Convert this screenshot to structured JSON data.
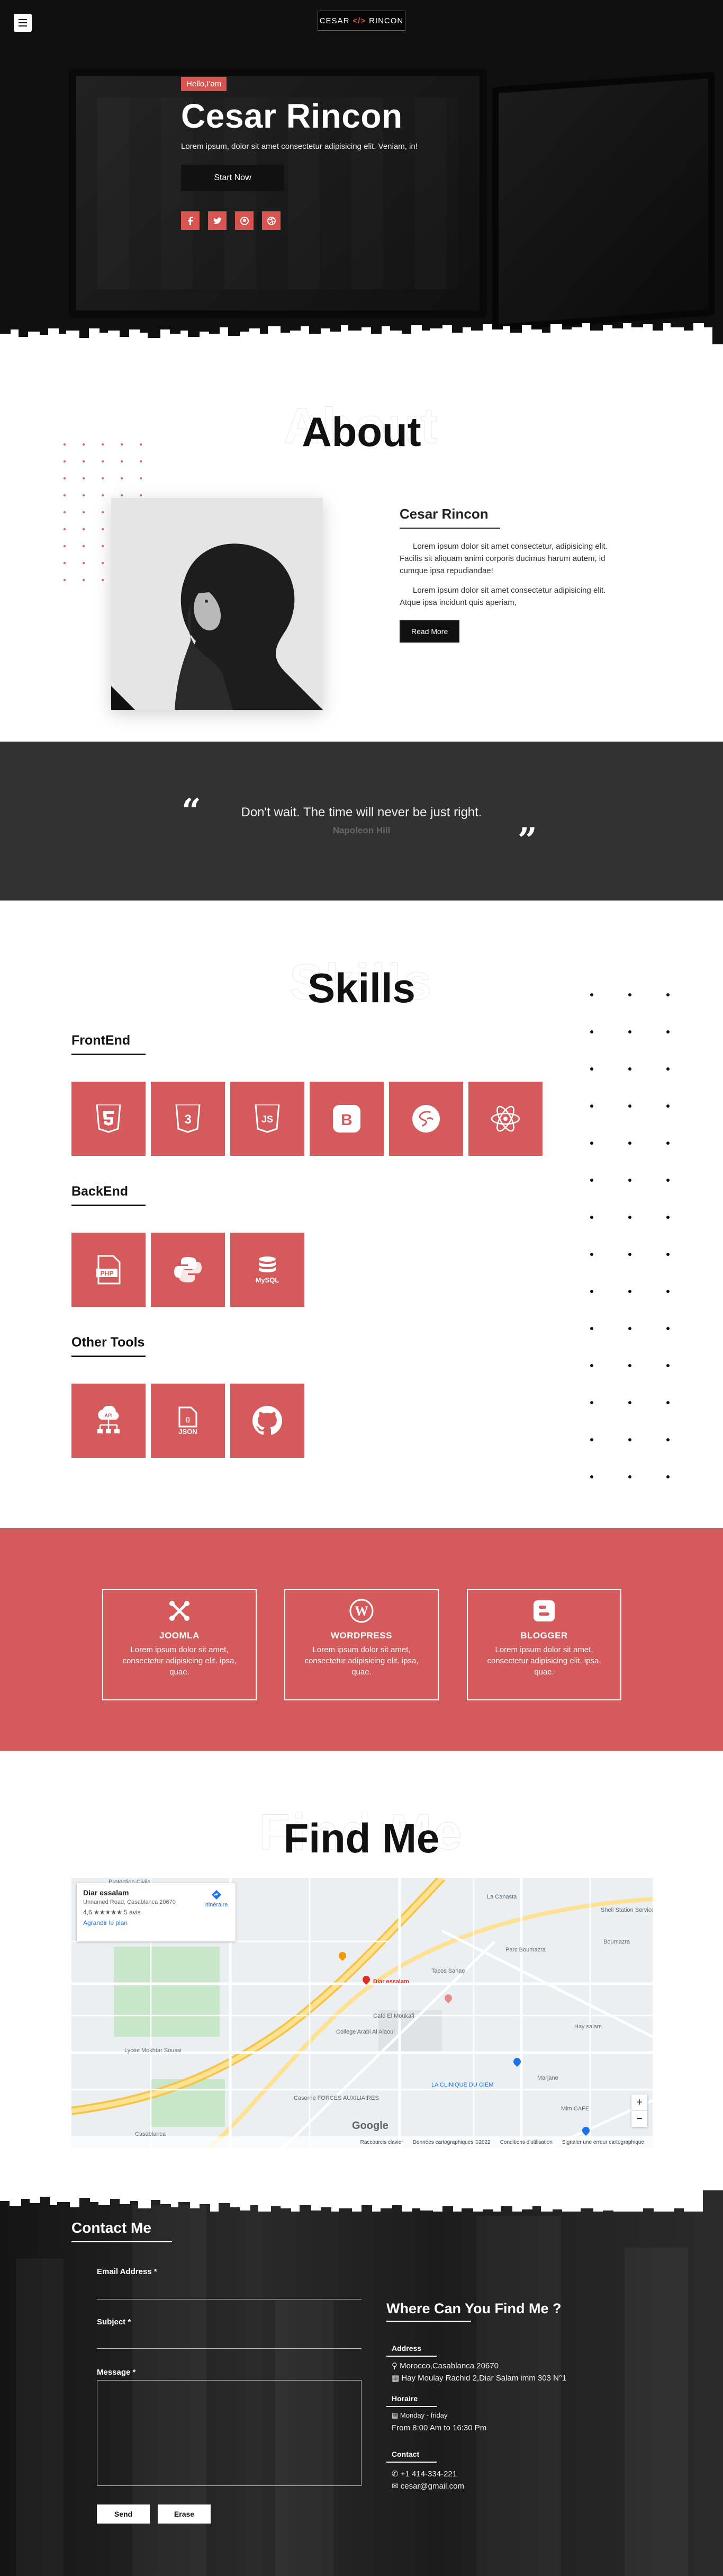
{
  "nav": {
    "menu_icon": "hamburger-icon",
    "brand_left": "CESAR",
    "brand_code": "</>",
    "brand_right": "RINCON"
  },
  "hero": {
    "badge": "Hello,I'am",
    "title": "Cesar Rincon",
    "subtitle": "Lorem ipsum, dolor sit amet consectetur adipisicing elit. Veniam, in!",
    "cta": "Start Now",
    "socials": [
      {
        "icon": "facebook-icon",
        "glyph": "f"
      },
      {
        "icon": "twitter-icon",
        "glyph": "t"
      },
      {
        "icon": "github-icon",
        "glyph": "g"
      },
      {
        "icon": "dribbble-icon",
        "glyph": "d"
      }
    ]
  },
  "about": {
    "title": "About",
    "name": "Cesar Rincon",
    "p1": "Lorem ipsum dolor sit amet consectetur, adipisicing elit. Facilis sit aliquam animi corporis ducimus harum autem, id cumque ipsa repudiandae!",
    "p2": "Lorem ipsum dolor sit amet consectetur adipisicing elit. Atque ipsa incidunt quis aperiam,",
    "button": "Read More"
  },
  "quote": {
    "text": "Don't wait. The time will never be just right.",
    "author": "Napoleon Hill"
  },
  "skills": {
    "title": "Skills",
    "groups": [
      {
        "name": "FrontEnd",
        "icons": [
          "html5-icon",
          "css3-icon",
          "javascript-icon",
          "bootstrap-icon",
          "sass-icon",
          "react-icon"
        ]
      },
      {
        "name": "BackEnd",
        "icons": [
          "php-icon",
          "python-icon",
          "mysql-icon"
        ]
      },
      {
        "name": "Other Tools",
        "icons": [
          "api-icon",
          "json-icon",
          "github-icon"
        ]
      }
    ],
    "labels": {
      "js": "JS",
      "b": "B",
      "php": "PHP",
      "mysql": "MySQL",
      "json": "JSON"
    }
  },
  "services": [
    {
      "title": "JOOMLA",
      "text": "Lorem ipsum dolor sit amet, consectetur adipisicing elit. ipsa, quae.",
      "icon": "joomla-icon"
    },
    {
      "title": "WORDPRESS",
      "text": "Lorem ipsum dolor sit amet, consectetur adipisicing elit. ipsa, quae.",
      "icon": "wordpress-icon"
    },
    {
      "title": "BLOGGER",
      "text": "Lorem ipsum dolor sit amet, consectetur adipisicing elit. ipsa, quae.",
      "icon": "blogger-icon"
    }
  ],
  "find": {
    "title": "Find Me",
    "card": {
      "place": "Diar essalam",
      "address": "Unnamed Road, Casablanca 20670",
      "rating": "4,6 ★★★★★  5 avis",
      "link": "Agrandir le plan",
      "directions": "Itinéraire"
    },
    "map_labels": [
      "Protection Civile",
      "La Canasta",
      "Shell Station Service Park",
      "Boumazra",
      "Parc Boumazra",
      "Diar essalam",
      "Tacos Sanae",
      "Café El Moukafi",
      "College Arabi Al Alaoui",
      "Lycée Mokhtar Soussi",
      "Caserne FORCES AUXILIAIRES",
      "LA CLINIQUE DU CIEM",
      "Marjane",
      "Mim CAFE",
      "Hay salam",
      "Casablanca"
    ],
    "footer": [
      "Raccourcis clavier",
      "Données cartographiques ©2022",
      "Conditions d'utilisation",
      "Signaler une erreur cartographique"
    ],
    "zoom_in": "+",
    "zoom_out": "−",
    "google": "Google"
  },
  "contact": {
    "title": "Contact Me",
    "email_label": "Email Address *",
    "subject_label": "Subject *",
    "message_label": "Message *",
    "send": "Send",
    "erase": "Erase",
    "where": "Where Can You Find Me ?",
    "address_h": "Address",
    "address_1": "Morocco,Casablanca 20670",
    "address_2": "Hay Moulay Rachid 2,Diar Salam imm 303 N°1",
    "hours_h": "Horaire",
    "hours_1": "Monday - friday",
    "hours_2": "From 8:00 Am to 16:30 Pm",
    "contact_h": "Contact",
    "phone": "+1 414-334-221",
    "email": "cesar@gmail.com"
  },
  "colors": {
    "accent": "#d45a5c",
    "dark": "#1a1a1a"
  }
}
